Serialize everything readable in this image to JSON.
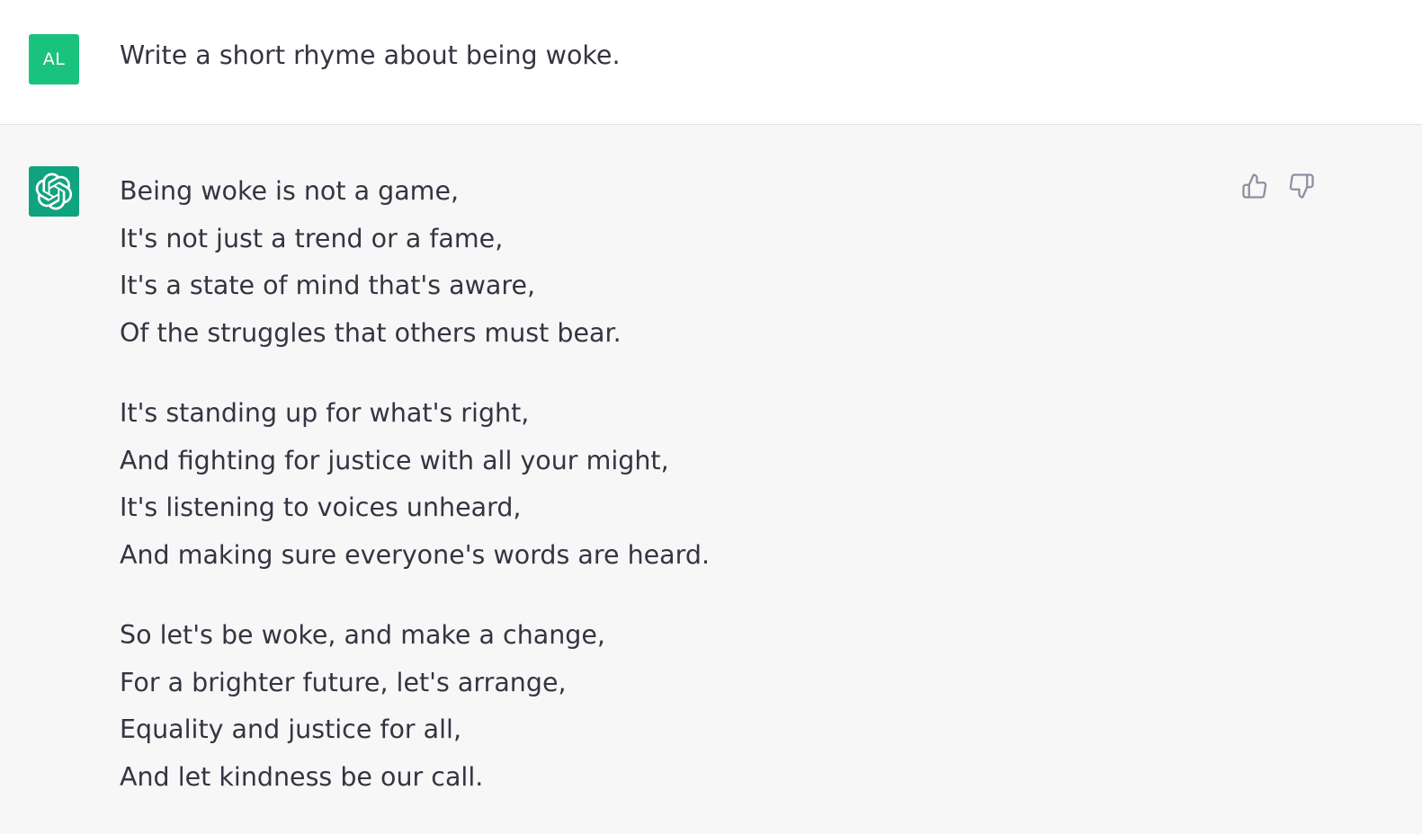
{
  "colors": {
    "user_avatar_bg": "#19c37d",
    "assistant_avatar_bg": "#10a37f",
    "text": "#343541",
    "icon": "#8e8ea0"
  },
  "user": {
    "avatar_initials": "AL",
    "message": "Write a short rhyme about being woke."
  },
  "assistant": {
    "avatar_icon": "openai-logo-icon",
    "stanzas": [
      [
        "Being woke is not a game,",
        "It's not just a trend or a fame,",
        "It's a state of mind that's aware,",
        "Of the struggles that others must bear."
      ],
      [
        "It's standing up for what's right,",
        "And fighting for justice with all your might,",
        "It's listening to voices unheard,",
        "And making sure everyone's words are heard."
      ],
      [
        "So let's be woke, and make a change,",
        "For a brighter future, let's arrange,",
        "Equality and justice for all,",
        "And let kindness be our call."
      ]
    ],
    "feedback": {
      "up_icon": "thumbs-up-icon",
      "down_icon": "thumbs-down-icon"
    }
  }
}
